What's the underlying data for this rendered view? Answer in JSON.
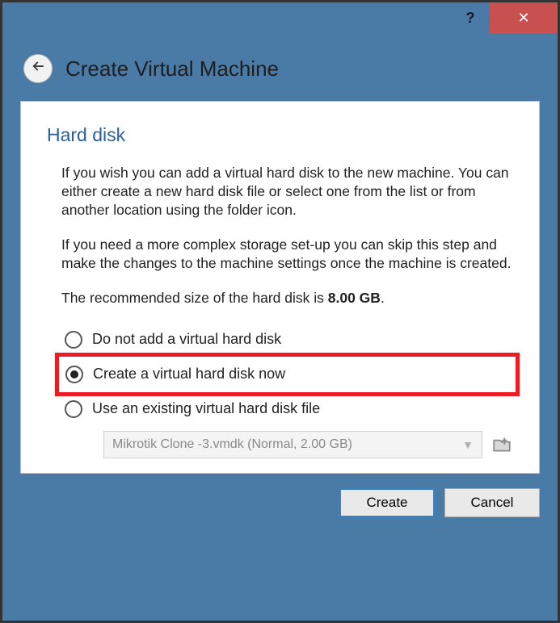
{
  "titlebar": {
    "help": "?",
    "close": "✕"
  },
  "header": {
    "back_glyph": "←",
    "title": "Create Virtual Machine"
  },
  "section": {
    "heading": "Hard disk",
    "para1": "If you wish you can add a virtual hard disk to the new machine. You can either create a new hard disk file or select one from the list or from another location using the folder icon.",
    "para2": "If you need a more complex storage set-up you can skip this step and make the changes to the machine settings once the machine is created.",
    "recommended_prefix": "The recommended size of the hard disk is ",
    "recommended_value": "8.00 GB",
    "recommended_suffix": "."
  },
  "options": {
    "none": "Do not add a virtual hard disk",
    "create": "Create a virtual hard disk now",
    "existing": "Use an existing virtual hard disk file",
    "selected": "create",
    "file_value": "Mikrotik Clone -3.vmdk (Normal, 2.00 GB)"
  },
  "buttons": {
    "create": "Create",
    "cancel": "Cancel"
  }
}
